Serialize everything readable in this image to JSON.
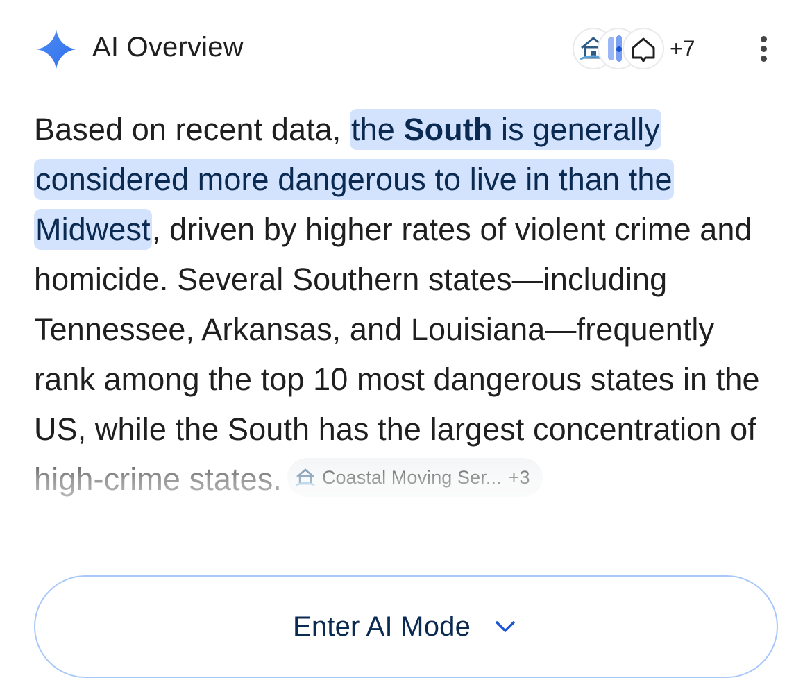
{
  "header": {
    "title": "AI Overview",
    "sources": [
      {
        "icon": "house-logo-icon"
      },
      {
        "icon": "slider-logo-icon"
      },
      {
        "icon": "house-outline-logo-icon"
      }
    ],
    "sources_more": "+7",
    "menu_icon": "more-vert-icon"
  },
  "overview": {
    "intro": "Based on recent data, ",
    "highlight_pre": "the ",
    "highlight_bold": "South",
    "highlight_post": " is generally considered more dangerous to live in than the Midwest",
    "rest": ", driven by higher rates of violent crime and homicide. Several Southern states—including Tennessee, Arkansas, and Louisiana—frequently rank among the top 10 most dangerous states in the US, while the South has the largest concentration of high-crime states.",
    "citation": {
      "label": "Coastal Moving Ser...",
      "more": "+3",
      "icon": "house-logo-icon"
    }
  },
  "ai_mode_button": {
    "label": "Enter AI Mode",
    "icon": "chevron-down-icon"
  },
  "colors": {
    "highlight_bg": "#d3e3fd",
    "highlight_text": "#0b2a52",
    "button_border": "#a8c7fa",
    "spark_blue": "#4285f4"
  }
}
